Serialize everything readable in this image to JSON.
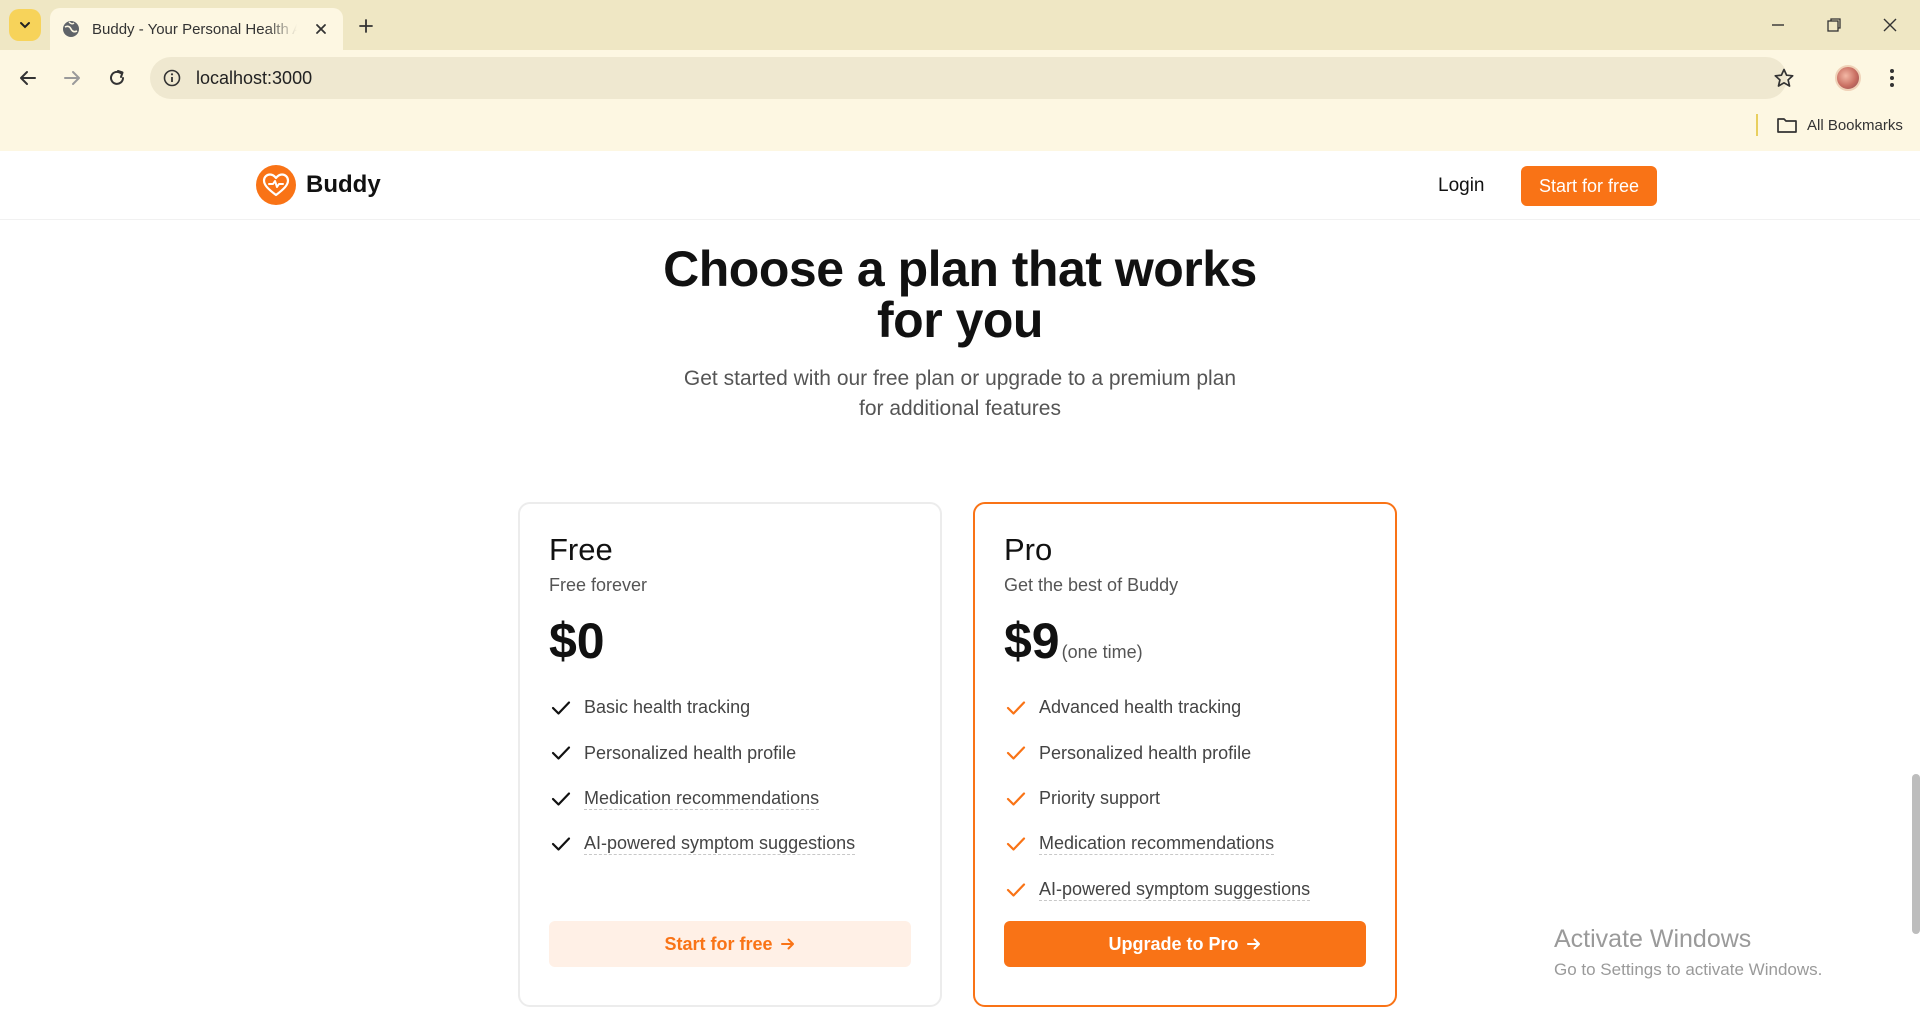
{
  "browser": {
    "tab_title": "Buddy - Your Personal Health Assistant",
    "url": "localhost:3000",
    "bookmarks_label": "All Bookmarks"
  },
  "site": {
    "brand": "Buddy",
    "login": "Login",
    "header_cta": "Start for free",
    "accent_color": "#f97316"
  },
  "hero": {
    "title_line1": "Choose a plan that works",
    "title_line2": "for you",
    "subtitle_line1": "Get started with our free plan or upgrade to a premium plan",
    "subtitle_line2": "for additional features"
  },
  "plans": {
    "free": {
      "name": "Free",
      "tagline": "Free forever",
      "price": "$0",
      "features": [
        "Basic health tracking",
        "Personalized health profile",
        "Medication recommendations",
        "AI-powered symptom suggestions"
      ],
      "cta": "Start for free"
    },
    "pro": {
      "name": "Pro",
      "tagline": "Get the best of Buddy",
      "price": "$9",
      "price_note": "(one time)",
      "features": [
        "Advanced health tracking",
        "Personalized health profile",
        "Priority support",
        "Medication recommendations",
        "AI-powered symptom suggestions"
      ],
      "cta": "Upgrade to Pro"
    }
  },
  "watermark": {
    "title": "Activate Windows",
    "subtitle": "Go to Settings to activate Windows."
  }
}
